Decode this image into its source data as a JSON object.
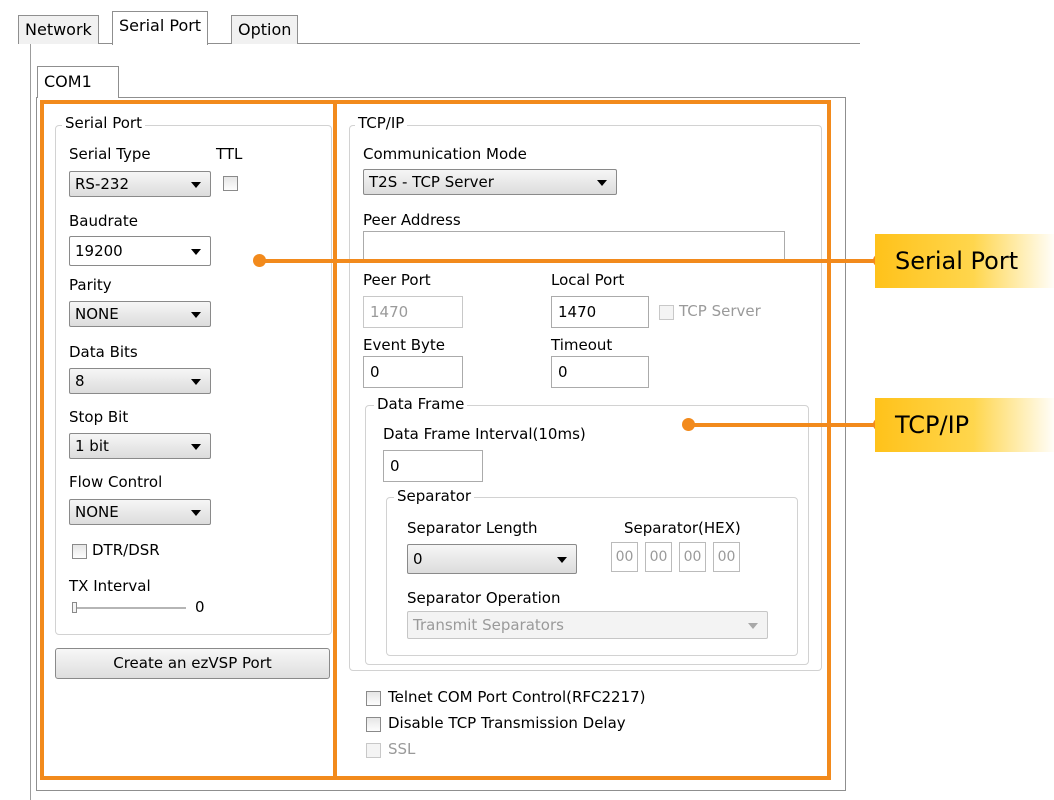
{
  "tabs": [
    "Network",
    "Serial Port",
    "Option"
  ],
  "com_tab": "COM1",
  "serial": {
    "group_title": "Serial Port",
    "serial_type_label": "Serial Type",
    "ttl_label": "TTL",
    "serial_type_value": "RS-232",
    "baudrate_label": "Baudrate",
    "baudrate_value": "19200",
    "parity_label": "Parity",
    "parity_value": "NONE",
    "data_bits_label": "Data Bits",
    "data_bits_value": "8",
    "stop_bit_label": "Stop Bit",
    "stop_bit_value": "1 bit",
    "flow_control_label": "Flow Control",
    "flow_control_value": "NONE",
    "dtr_dsr_label": "DTR/DSR",
    "tx_interval_label": "TX Interval",
    "tx_interval_value": "0",
    "create_button": "Create an ezVSP Port"
  },
  "tcpip": {
    "group_title": "TCP/IP",
    "comm_mode_label": "Communication Mode",
    "comm_mode_value": "T2S - TCP Server",
    "peer_address_label": "Peer Address",
    "peer_address_value": "",
    "peer_port_label": "Peer Port",
    "peer_port_value": "1470",
    "local_port_label": "Local Port",
    "local_port_value": "1470",
    "tcp_server_label": "TCP Server",
    "event_byte_label": "Event Byte",
    "event_byte_value": "0",
    "timeout_label": "Timeout",
    "timeout_value": "0",
    "data_frame": {
      "title": "Data Frame",
      "interval_label": "Data Frame Interval(10ms)",
      "interval_value": "0"
    },
    "separator": {
      "title": "Separator",
      "length_label": "Separator Length",
      "length_value": "0",
      "hex_label": "Separator(HEX)",
      "hex_values": [
        "00",
        "00",
        "00",
        "00"
      ],
      "operation_label": "Separator Operation",
      "operation_value": "Transmit Separators"
    },
    "telnet_label": "Telnet COM Port Control(RFC2217)",
    "disable_delay_label": "Disable TCP Transmission Delay",
    "ssl_label": "SSL"
  },
  "callouts": {
    "serial_port": "Serial Port",
    "tcpip": "TCP/IP"
  },
  "accent_color": "#f28a1c"
}
